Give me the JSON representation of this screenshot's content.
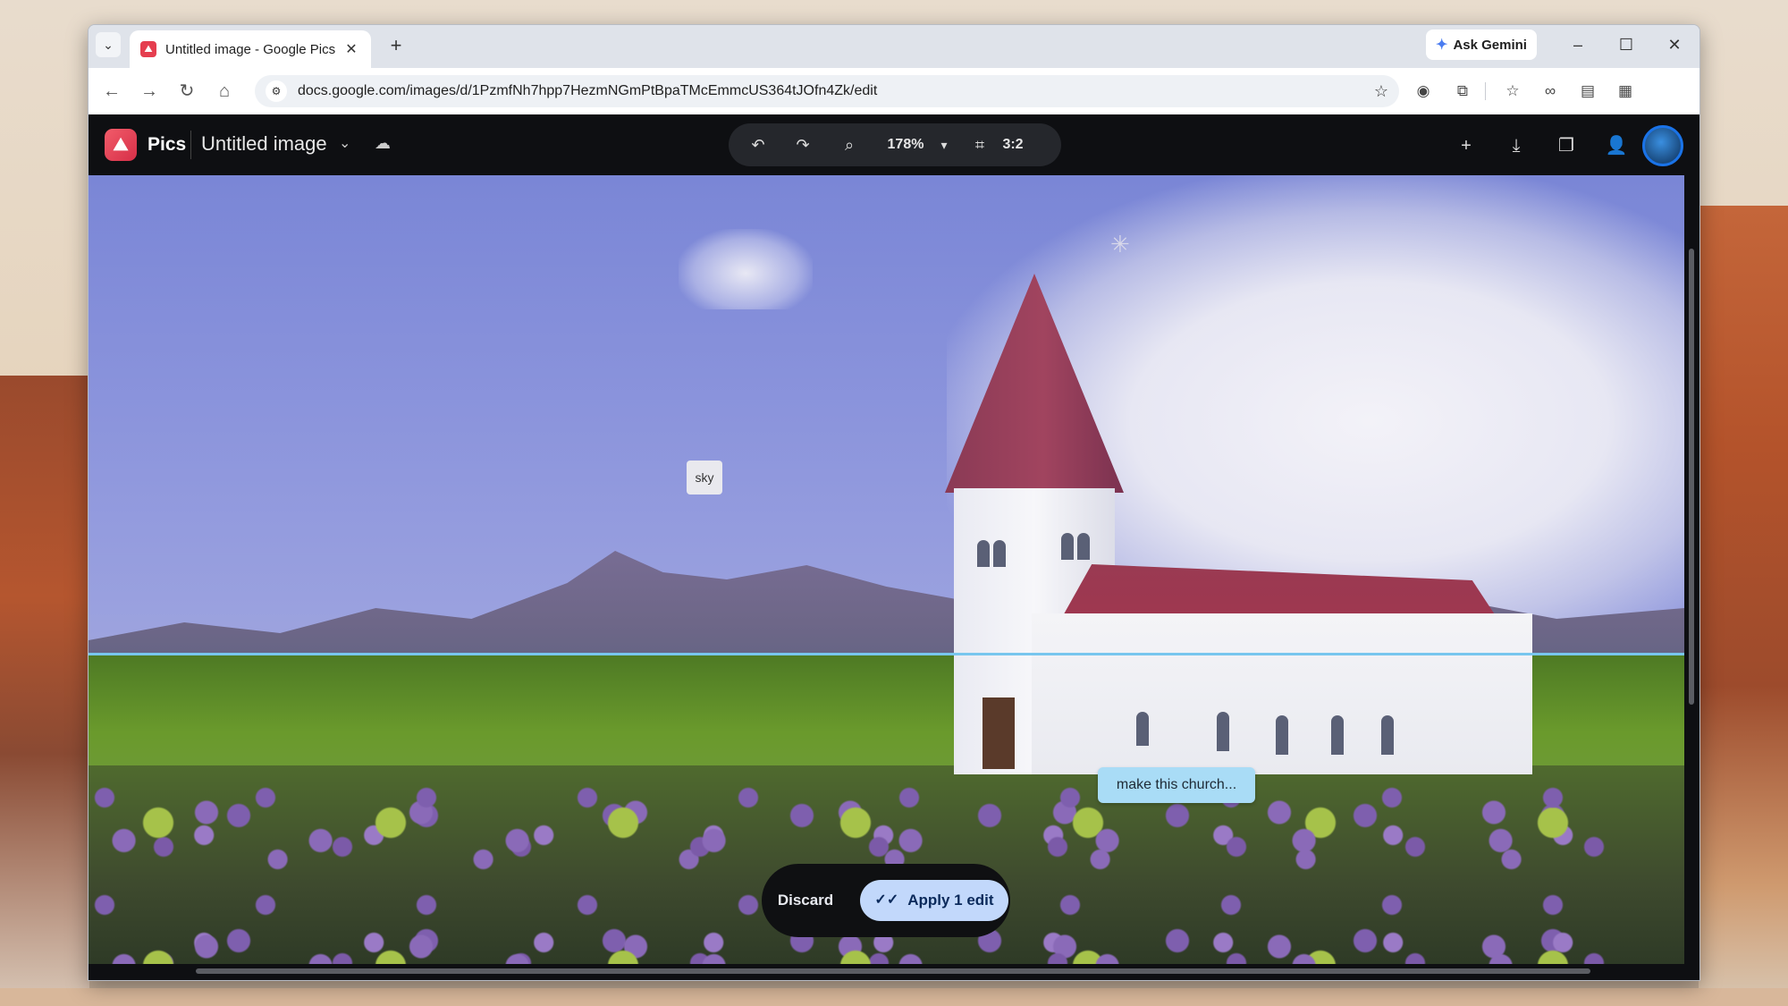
{
  "browser": {
    "tab": {
      "title": "Untitled image - Google Pics",
      "favicon": "pics-favicon",
      "close_glyph": "✕"
    },
    "new_tab_glyph": "+",
    "ask_gemini": "Ask Gemini",
    "url": "docs.google.com/images/d/1PzmfNh7hpp7HezmNGmPtBpaTMcEmmcUS364tJOfn4Zk/edit",
    "window_controls": {
      "minimize": "–",
      "maximize": "☐",
      "close": "✕"
    },
    "icons": {
      "back": "←",
      "forward": "→",
      "reload": "↻",
      "home": "⌂",
      "site_info": "⚙",
      "star": "☆",
      "camera": "◉",
      "extensions": "⧉",
      "bookmarks": "☆",
      "link": "∞",
      "reader": "▤",
      "sidebar": "▦",
      "download": "⤓",
      "menu": "⋮",
      "tab_search": "⌄"
    }
  },
  "app": {
    "logo_glyph": "⛰",
    "name": "Pics",
    "doc_title": "Untitled image",
    "title_chevron": "⌄",
    "cloud_glyph": "☁",
    "toolbar": {
      "undo": "↶",
      "redo": "↷",
      "zoom_icon": "⌕",
      "zoom": "178%",
      "zoom_caret": "▾",
      "crop_icon": "⌗",
      "ratio": "3:2"
    },
    "header_right": {
      "add": "+",
      "download": "⤓",
      "copy": "❐",
      "share": "👤"
    }
  },
  "canvas": {
    "region_label": "sky",
    "prompt": "make this church...",
    "selection_line_color": "#78c6ee",
    "cross_glyph": "✳"
  },
  "actions": {
    "discard": "Discard",
    "apply": "Apply 1 edit",
    "apply_icon": "✓✓"
  },
  "colors": {
    "accent": "#1a73e8",
    "apply_bg": "#c2d8fb",
    "logo": "#e53e4f"
  }
}
